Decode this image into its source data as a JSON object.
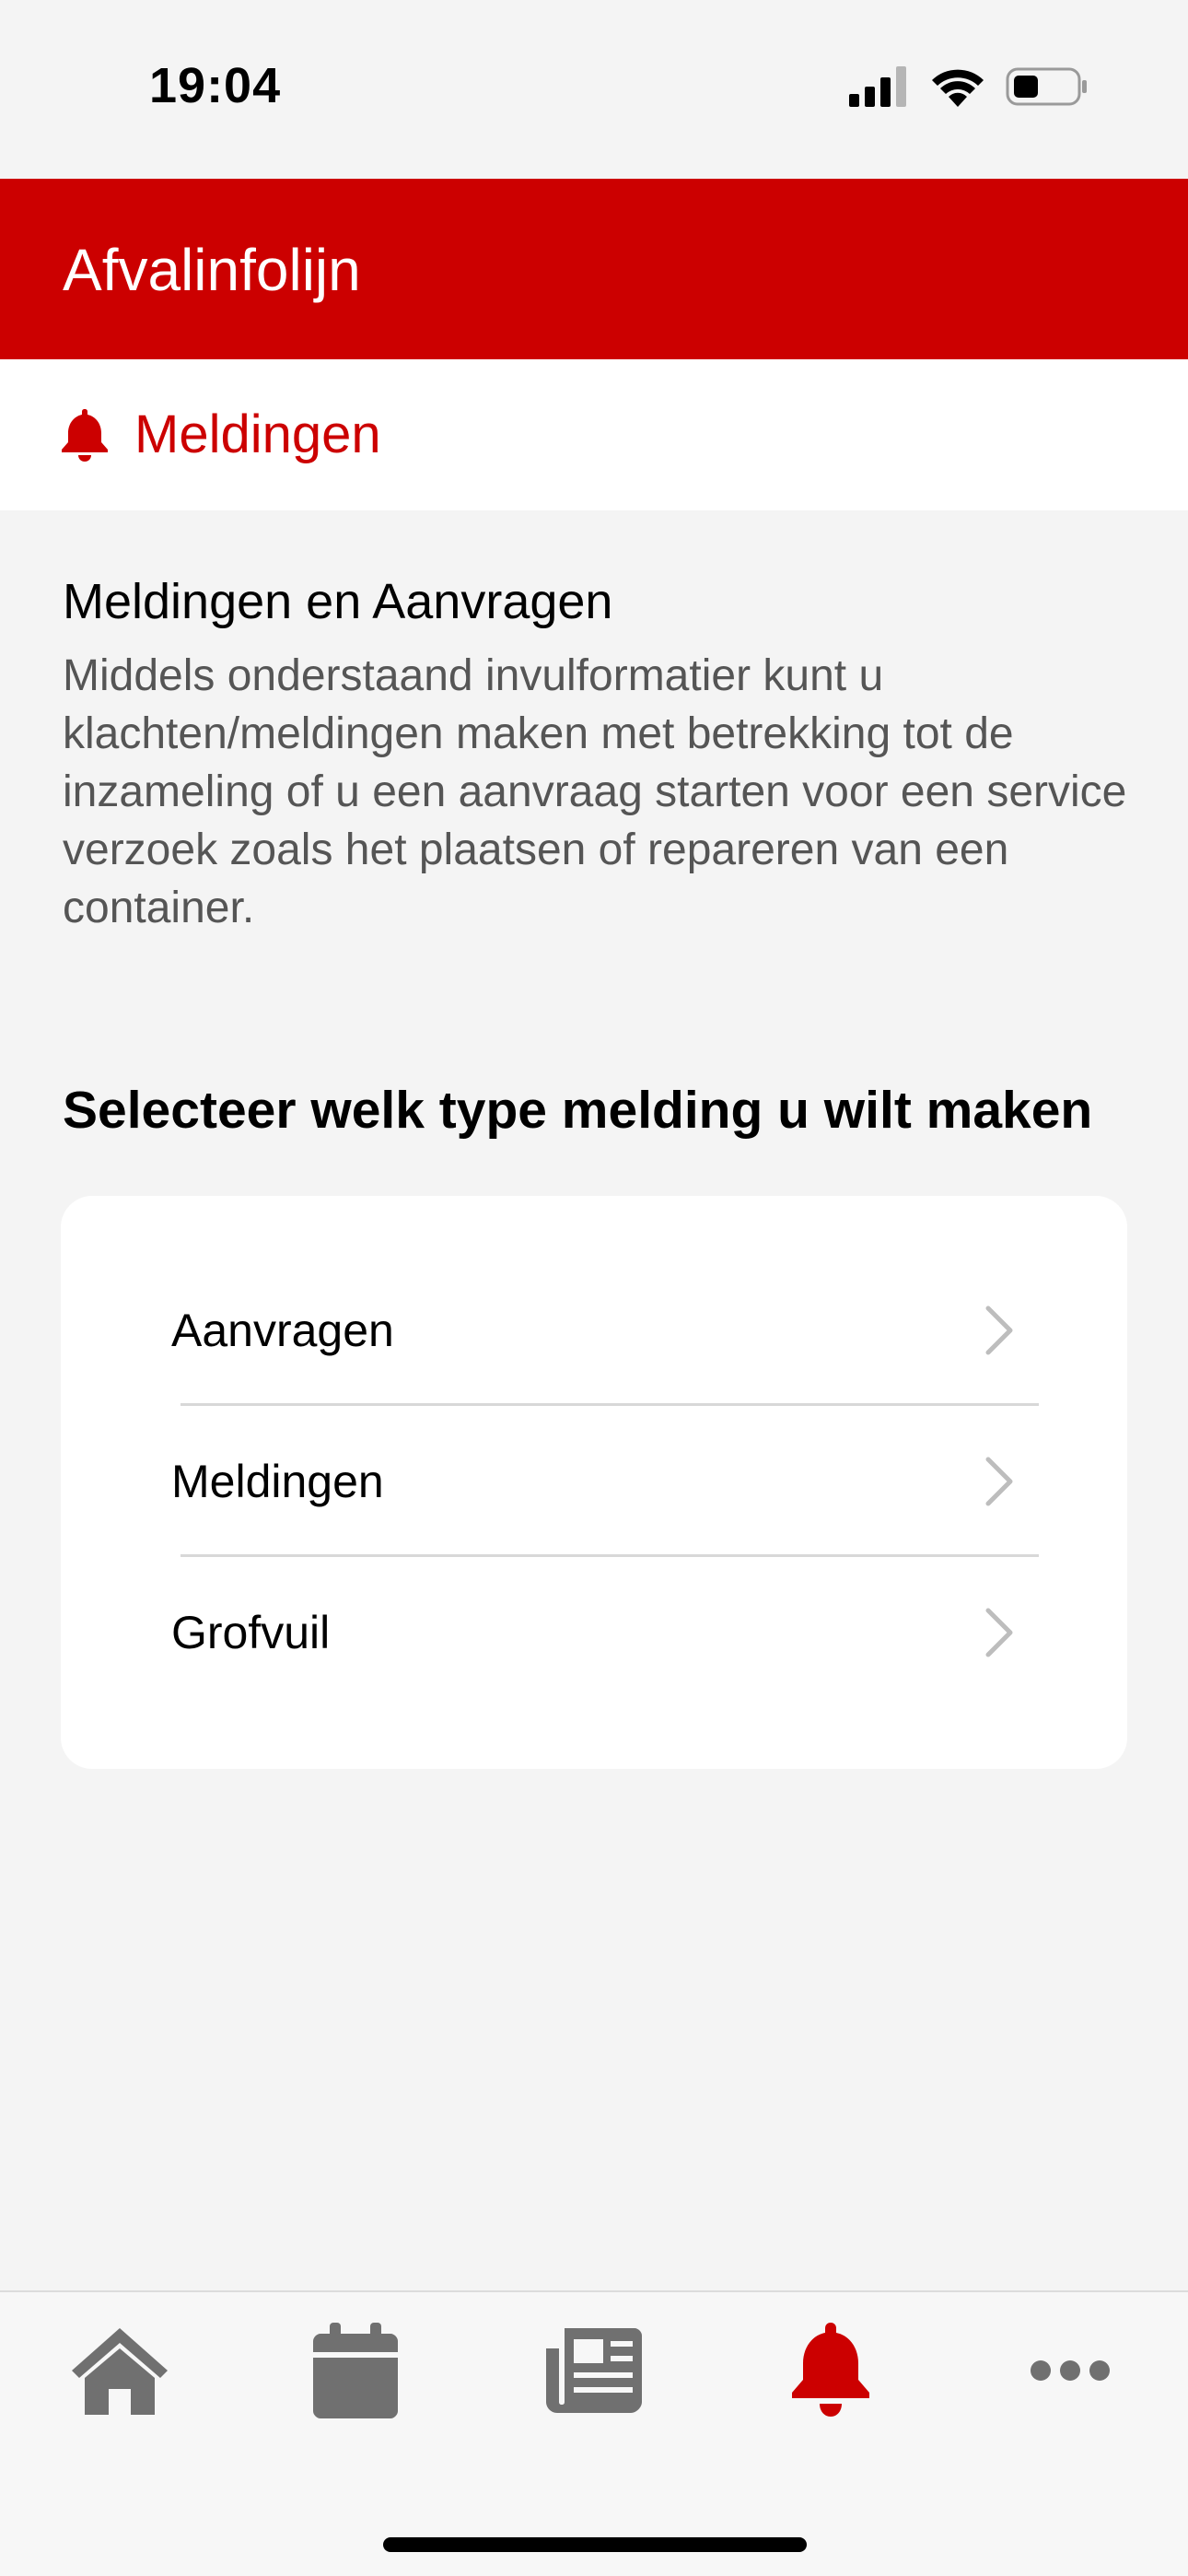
{
  "status_bar": {
    "time": "19:04",
    "icons": [
      "cellular-icon",
      "wifi-icon",
      "battery-icon"
    ]
  },
  "header": {
    "title": "Afvalinfolijn"
  },
  "section": {
    "label": "Meldingen",
    "icon": "bell-icon"
  },
  "intro": {
    "title": "Meldingen en Aanvragen",
    "text": "Middels onderstaand invulformatier kunt u klachten/meldingen maken met betrekking tot de inzameling of u een aanvraag starten voor een service verzoek zoals het plaatsen of repareren van een container."
  },
  "select_heading": "Selecteer welk type melding u wilt maken",
  "options": [
    {
      "label": "Aanvragen"
    },
    {
      "label": "Meldingen"
    },
    {
      "label": "Grofvuil"
    }
  ],
  "tab_bar": {
    "tabs": [
      {
        "icon": "home-icon",
        "active": false
      },
      {
        "icon": "calendar-icon",
        "active": false
      },
      {
        "icon": "newspaper-icon",
        "active": false
      },
      {
        "icon": "bell-icon",
        "active": true
      },
      {
        "icon": "more-icon",
        "active": false
      }
    ]
  },
  "colors": {
    "brand": "#cc0000",
    "background": "#f4f4f4",
    "tab_inactive": "#707070"
  }
}
